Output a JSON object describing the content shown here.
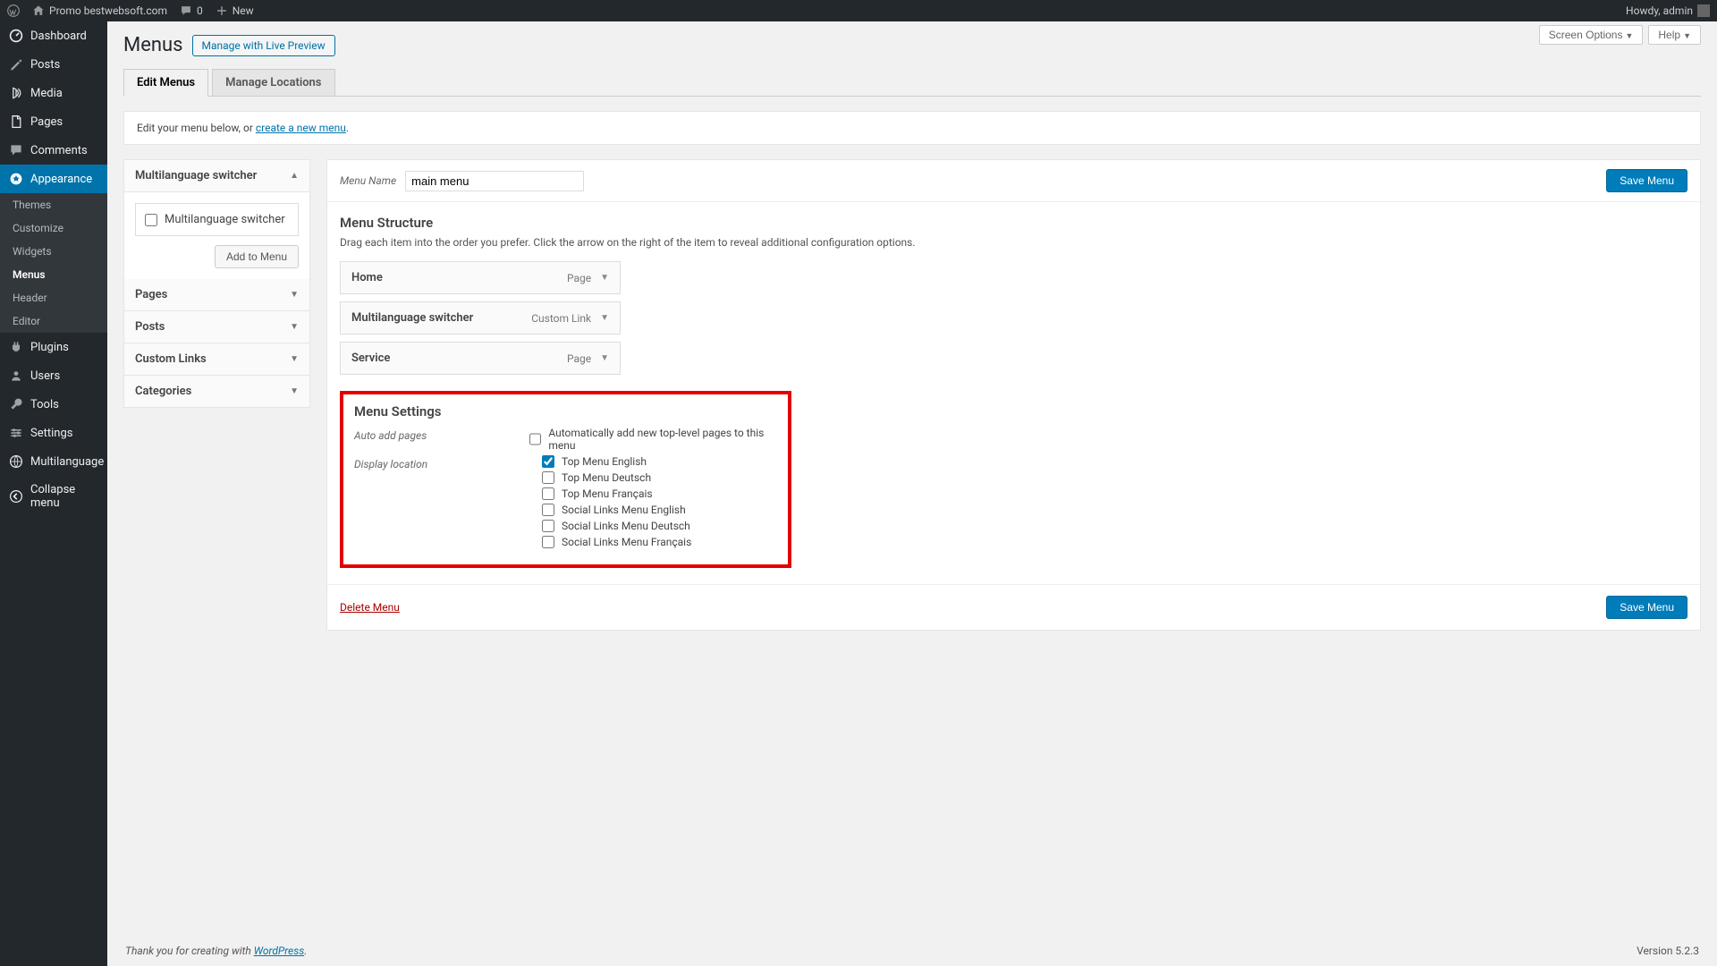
{
  "adminbar": {
    "site": "Promo bestwebsoft.com",
    "comments": "0",
    "new": "New",
    "greeting": "Howdy, admin"
  },
  "sidebar": {
    "dashboard": "Dashboard",
    "posts": "Posts",
    "media": "Media",
    "pages": "Pages",
    "comments": "Comments",
    "appearance": "Appearance",
    "themes": "Themes",
    "customize": "Customize",
    "widgets": "Widgets",
    "menus": "Menus",
    "header": "Header",
    "editor": "Editor",
    "plugins": "Plugins",
    "users": "Users",
    "tools": "Tools",
    "settings": "Settings",
    "multilanguage": "Multilanguage",
    "collapse": "Collapse menu"
  },
  "page": {
    "screen_options": "Screen Options",
    "help": "Help",
    "title": "Menus",
    "live_preview": "Manage with Live Preview",
    "tab_edit": "Edit Menus",
    "tab_locations": "Manage Locations",
    "notice_prefix": "Edit your menu below, or ",
    "notice_link": "create a new menu",
    "footer_text": "Thank you for creating with ",
    "footer_link": "WordPress",
    "version": "Version 5.2.3"
  },
  "accordion": {
    "multilang": "Multilanguage switcher",
    "multilang_cb": "Multilanguage switcher",
    "add_to_menu": "Add to Menu",
    "pages": "Pages",
    "posts": "Posts",
    "custom_links": "Custom Links",
    "categories": "Categories"
  },
  "menu": {
    "name_label": "Menu Name",
    "name_value": "main menu",
    "save": "Save Menu",
    "structure_title": "Menu Structure",
    "structure_desc": "Drag each item into the order you prefer. Click the arrow on the right of the item to reveal additional configuration options.",
    "items": [
      {
        "title": "Home",
        "type": "Page"
      },
      {
        "title": "Multilanguage switcher",
        "type": "Custom Link"
      },
      {
        "title": "Service",
        "type": "Page"
      }
    ],
    "settings_title": "Menu Settings",
    "auto_add_label": "Auto add pages",
    "auto_add_opt": "Automatically add new top-level pages to this menu",
    "display_label": "Display location",
    "locations": [
      {
        "label": "Top Menu English",
        "checked": true
      },
      {
        "label": "Top Menu Deutsch",
        "checked": false
      },
      {
        "label": "Top Menu Français",
        "checked": false
      },
      {
        "label": "Social Links Menu English",
        "checked": false
      },
      {
        "label": "Social Links Menu Deutsch",
        "checked": false
      },
      {
        "label": "Social Links Menu Français",
        "checked": false
      }
    ],
    "delete": "Delete Menu"
  }
}
